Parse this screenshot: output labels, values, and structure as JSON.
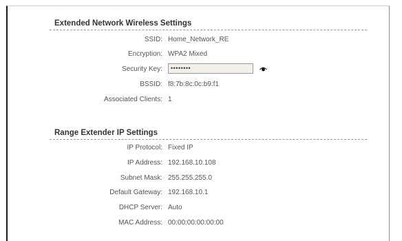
{
  "wireless": {
    "title": "Extended Network Wireless Settings",
    "ssid_label": "SSID:",
    "ssid_value": "Home_Network_RE",
    "encryption_label": "Encryption:",
    "encryption_value": "WPA2 Mixed",
    "security_key_label": "Security Key:",
    "security_key_value": "••••••••",
    "bssid_label": "BSSID:",
    "bssid_value": "f8:7b:8c:0c:b9:f1",
    "clients_label": "Associated Clients:",
    "clients_value": "1",
    "reveal_icon": "eye-icon"
  },
  "ip": {
    "title": "Range Extender IP Settings",
    "protocol_label": "IP Protocol:",
    "protocol_value": "Fixed IP",
    "address_label": "IP Address:",
    "address_value": "192.168.10.108",
    "mask_label": "Subnet Mask:",
    "mask_value": "255.255.255.0",
    "gateway_label": "Default Gateway:",
    "gateway_value": "192.168.10.1",
    "dhcp_label": "DHCP Server:",
    "dhcp_value": "Auto",
    "mac_label": "MAC Address:",
    "mac_value": "00:00:00:00:00:00"
  }
}
